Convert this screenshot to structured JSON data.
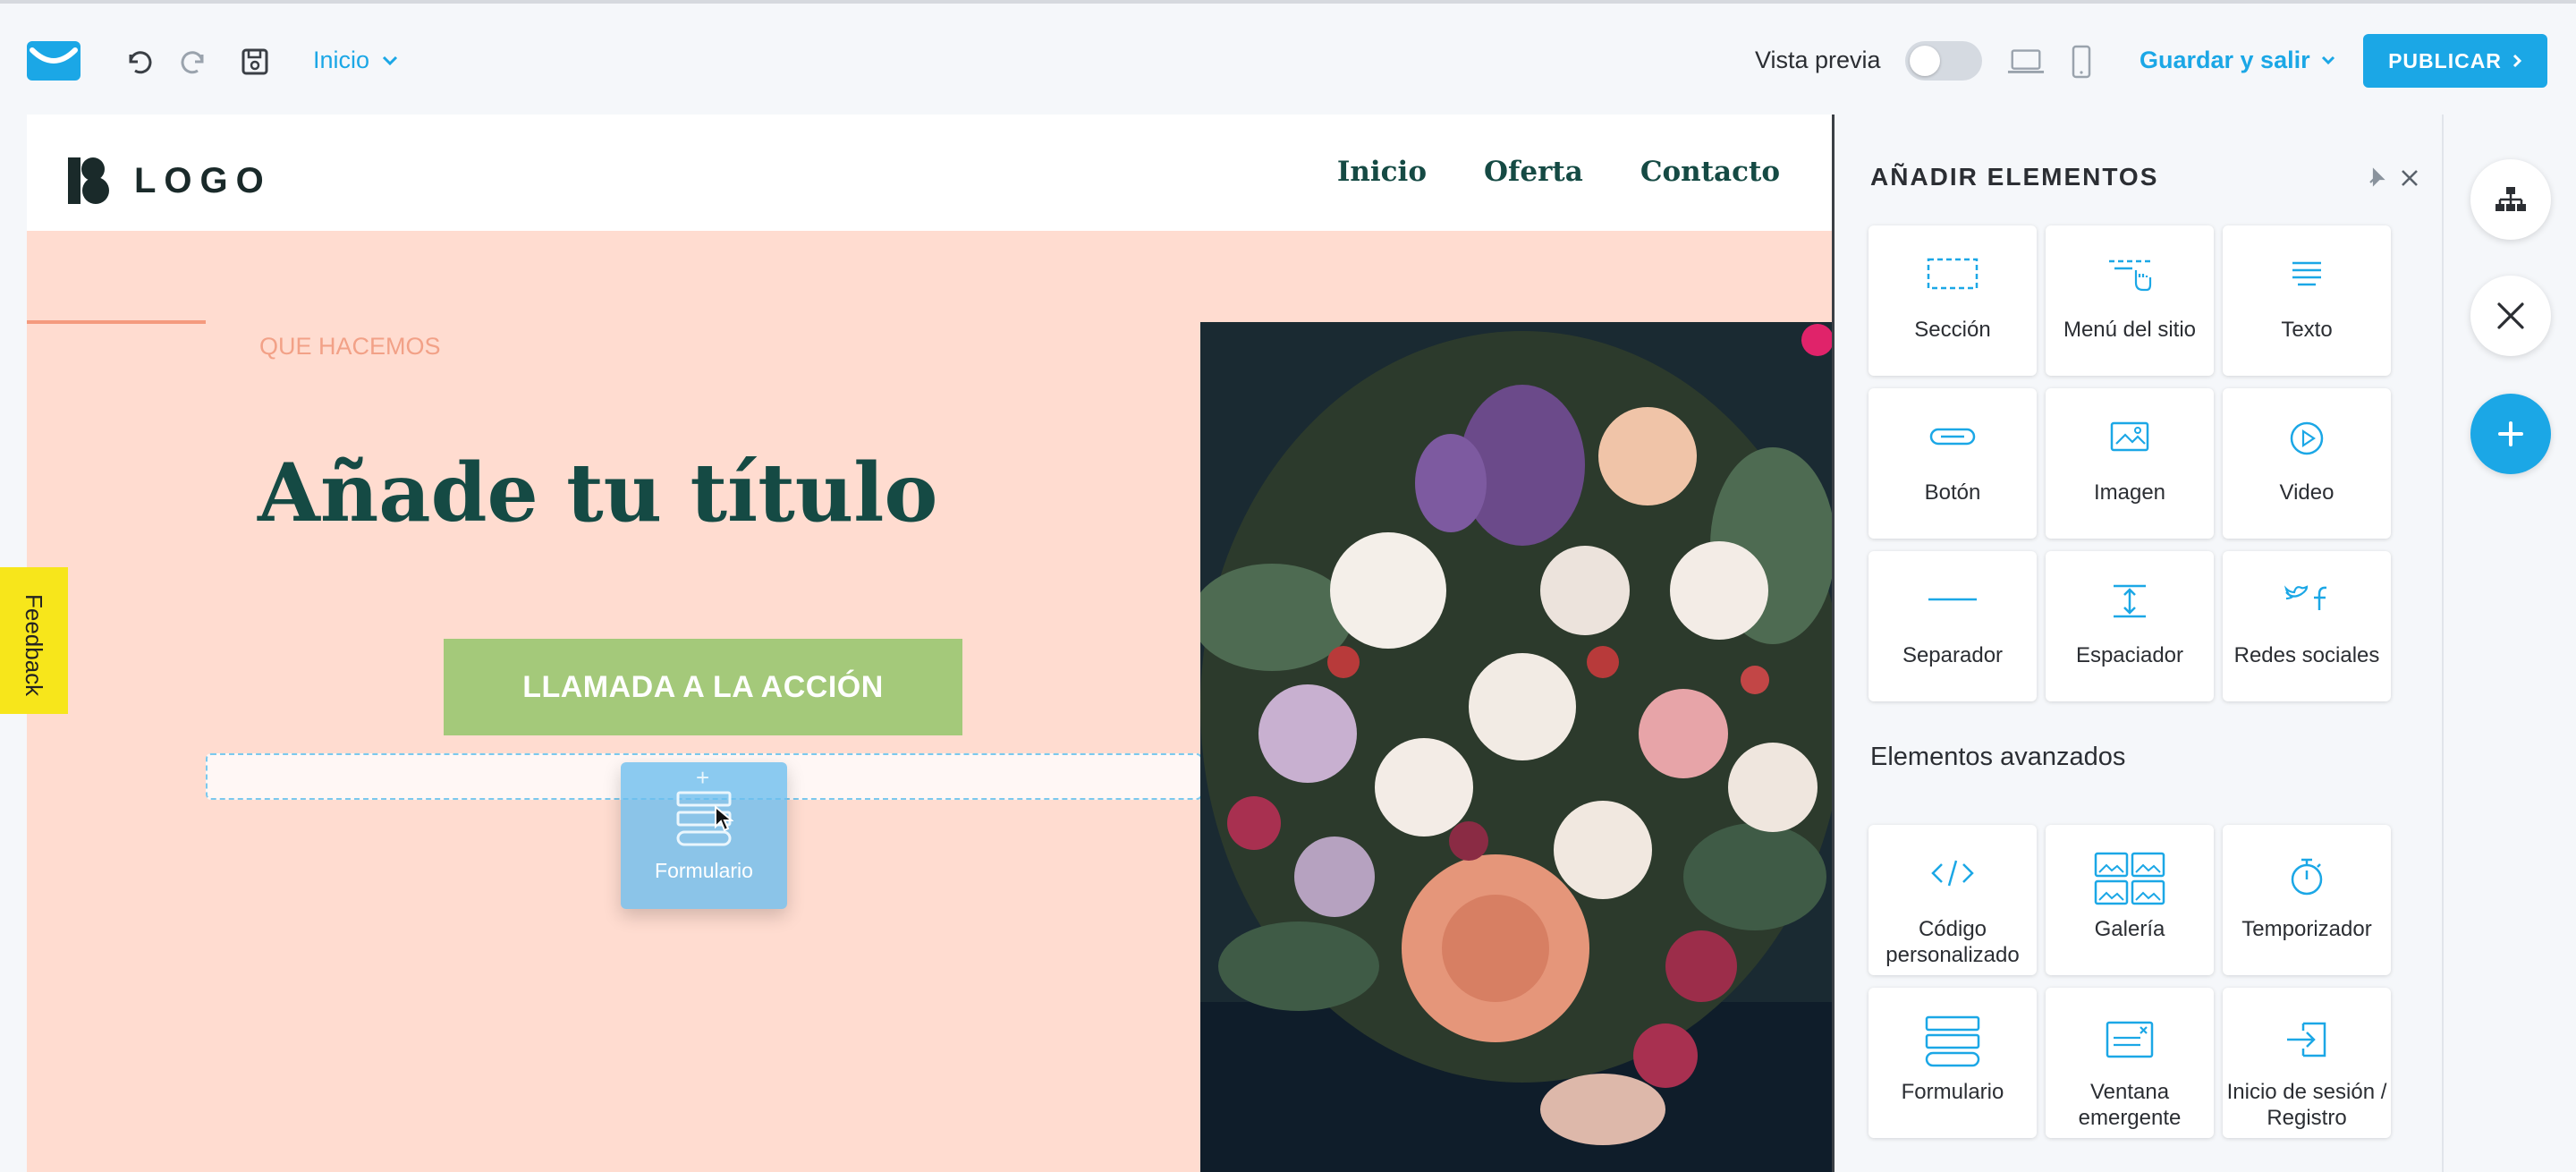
{
  "toolbar": {
    "page_selector": "Inicio",
    "preview_label": "Vista previa",
    "save_exit": "Guardar y salir",
    "publish": "PUBLICAR"
  },
  "site": {
    "logo_text": "LOGO",
    "nav": [
      "Inicio",
      "Oferta",
      "Contacto"
    ],
    "eyebrow": "QUE HACEMOS",
    "title": "Añade tu título",
    "cta": "LLAMADA A LA ACCIÓN"
  },
  "drag": {
    "label": "Formulario"
  },
  "feedback": "Feedback",
  "panel": {
    "title": "AÑADIR ELEMENTOS",
    "basic": [
      {
        "label": "Sección",
        "icon": "section-icon"
      },
      {
        "label": "Menú del sitio",
        "icon": "site-menu-icon"
      },
      {
        "label": "Texto",
        "icon": "text-icon"
      },
      {
        "label": "Botón",
        "icon": "button-icon"
      },
      {
        "label": "Imagen",
        "icon": "image-icon"
      },
      {
        "label": "Video",
        "icon": "video-icon"
      },
      {
        "label": "Separador",
        "icon": "separator-icon"
      },
      {
        "label": "Espaciador",
        "icon": "spacer-icon"
      },
      {
        "label": "Redes sociales",
        "icon": "social-icon"
      }
    ],
    "advanced_title": "Elementos avanzados",
    "advanced": [
      {
        "label": "Código personalizado",
        "icon": "code-icon"
      },
      {
        "label": "Galería",
        "icon": "gallery-icon"
      },
      {
        "label": "Temporizador",
        "icon": "timer-icon"
      },
      {
        "label": "Formulario",
        "icon": "form-icon"
      },
      {
        "label": "Ventana emergente",
        "icon": "popup-icon"
      },
      {
        "label": "Inicio de sesión / Registro",
        "icon": "login-icon"
      }
    ]
  },
  "colors": {
    "accent": "#1ba7e6",
    "canvas_bg": "#ffdcd0",
    "title_green": "#154a44",
    "cta_green": "#a4c97a",
    "eyebrow_orange": "#f2a187"
  }
}
